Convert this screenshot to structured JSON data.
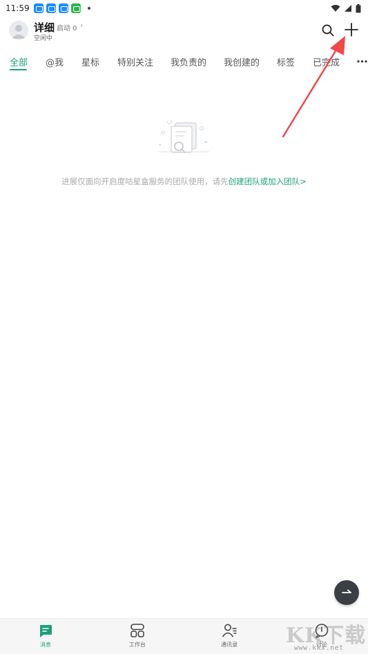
{
  "status_bar": {
    "time": "11:59",
    "icons": [
      "app-blue-icon",
      "app-blue-icon",
      "app-blue-icon",
      "app-green-icon"
    ],
    "right_icons": [
      "wifi-icon",
      "signal-icon",
      "battery-icon"
    ]
  },
  "header": {
    "title": "详细",
    "subtitle": "启动 0",
    "status": "空闲中"
  },
  "tabs": [
    {
      "label": "全部",
      "active": true
    },
    {
      "label": "@我"
    },
    {
      "label": "星标"
    },
    {
      "label": "特别关注"
    },
    {
      "label": "我负责的"
    },
    {
      "label": "我创建的"
    },
    {
      "label": "标签"
    },
    {
      "label": "已完成"
    }
  ],
  "empty_state": {
    "text": "进展仅面向开启度咕星盒服务的团队使用，请先",
    "link": "创建团队或加入团队>"
  },
  "bottom_nav": [
    {
      "label": "消息",
      "icon": "message-icon",
      "active": true
    },
    {
      "label": "工作台",
      "icon": "workbench-icon"
    },
    {
      "label": "通讯录",
      "icon": "contacts-icon"
    },
    {
      "label": "讨论",
      "icon": "discussion-icon"
    }
  ],
  "watermark": {
    "text": "KK下载",
    "url": "www.kkx.net"
  },
  "colors": {
    "accent": "#1aa079",
    "annotation": "#f0474a"
  }
}
